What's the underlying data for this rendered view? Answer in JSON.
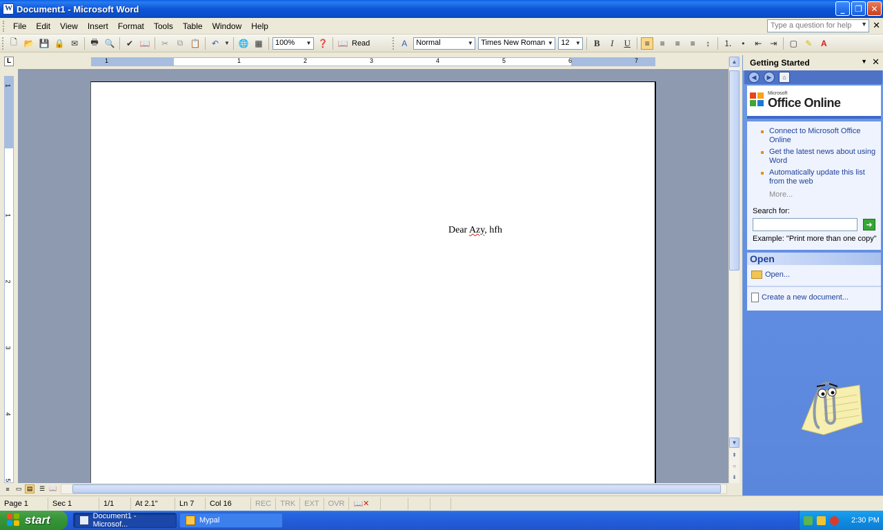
{
  "window": {
    "title": "Document1 - Microsoft Word"
  },
  "menu": {
    "items": [
      "File",
      "Edit",
      "View",
      "Insert",
      "Format",
      "Tools",
      "Table",
      "Window",
      "Help"
    ],
    "help_placeholder": "Type a question for help"
  },
  "toolbar": {
    "zoom": "100%",
    "read_label": "Read",
    "style": "Normal",
    "font": "Times New Roman",
    "size": "12"
  },
  "ruler": {
    "h_numbers": [
      "1",
      "1",
      "2",
      "3",
      "4",
      "5",
      "6",
      "7"
    ],
    "v_numbers": [
      "1",
      "1",
      "2",
      "3",
      "4",
      "5"
    ]
  },
  "document": {
    "word1": "Dear",
    "word2": "Azy",
    "word3": ", hfh"
  },
  "taskpane": {
    "title": "Getting Started",
    "logo_small": "Microsoft",
    "logo_big": "Office Online",
    "links": [
      "Connect to Microsoft Office Online",
      "Get the latest news about using Word",
      "Automatically update this list from the web"
    ],
    "more": "More...",
    "search_label": "Search for:",
    "example": "Example:  \"Print more than one copy\"",
    "open_header": "Open",
    "open_link": "Open...",
    "new_link": "Create a new document..."
  },
  "status": {
    "page": "Page  1",
    "sec": "Sec  1",
    "pages": "1/1",
    "at": "At  2.1\"",
    "ln": "Ln  7",
    "col": "Col  16",
    "rec": "REC",
    "trk": "TRK",
    "ext": "EXT",
    "ovr": "OVR"
  },
  "taskbar": {
    "start": "start",
    "task1": "Document1 - Microsof...",
    "task2": "Mypal",
    "clock": "2:30 PM"
  },
  "colors": {
    "title_blue": "#0a5fe6",
    "taskpane_blue": "#6f9ae6",
    "start_green": "#38963a"
  }
}
